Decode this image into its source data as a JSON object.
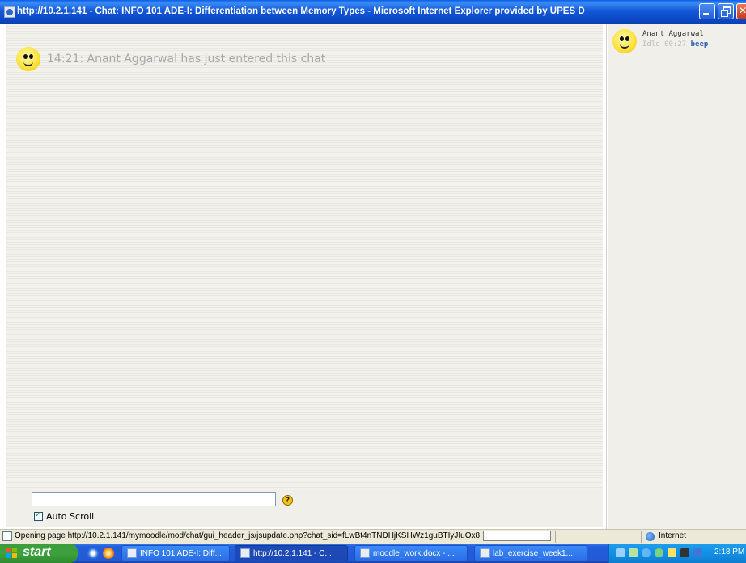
{
  "window": {
    "title": "http://10.2.1.141 - Chat: INFO 101 ADE-I: Differentiation between Memory Types - Microsoft Internet Explorer provided by UPES D"
  },
  "chat": {
    "messages": [
      {
        "time": "14:21",
        "text": "14:21: Anant Aggarwal has just entered this chat"
      }
    ],
    "input_value": "",
    "autoscroll_label": "Auto Scroll",
    "autoscroll_checked": true
  },
  "users": [
    {
      "name": "Anant Aggarwal",
      "idle": "Idle 00:27",
      "action": "beep"
    }
  ],
  "statusbar": {
    "text": "Opening page http://10.2.1.141/mymoodle/mod/chat/gui_header_js/jsupdate.php?chat_sid=fLwBt4nTNDHjKSHWz1guBTIyJIuOx8",
    "zone": "Internet"
  },
  "taskbar": {
    "start_label": "start",
    "buttons": [
      {
        "label": "INFO 101 ADE-I: Diff...",
        "active": false
      },
      {
        "label": "http://10.2.1.141 - C...",
        "active": true
      },
      {
        "label": "moodle_work.docx - ...",
        "active": false
      },
      {
        "label": "lab_exercise_week1....",
        "active": false
      }
    ],
    "clock": "2:18 PM"
  },
  "colors": {
    "title_bar": "#0b46c2",
    "chat_background": "#f2f1ec",
    "chat_text": "#a8a8a8",
    "beep_link": "#2a5db0",
    "taskbar": "#245edb",
    "start_button": "#3da23d"
  }
}
